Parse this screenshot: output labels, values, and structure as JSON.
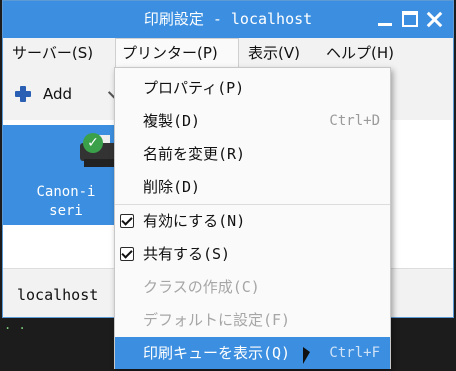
{
  "window": {
    "title": "印刷設定 - localhost"
  },
  "menubar": {
    "items": [
      {
        "label": "サーバー(S)"
      },
      {
        "label": "プリンター(P)"
      },
      {
        "label": "表示(V)"
      },
      {
        "label": "ヘルプ(H)"
      }
    ]
  },
  "toolbar": {
    "add_label": "Add"
  },
  "printer": {
    "name_line1": "Canon-i",
    "name_line2": "seri"
  },
  "status": {
    "server": "localhost"
  },
  "terminal": {
    "text": ". ."
  },
  "dropdown": {
    "items": [
      {
        "label": "プロパティ(P)",
        "accel": "",
        "checked": false,
        "disabled": false
      },
      {
        "label": "複製(D)",
        "accel": "Ctrl+D",
        "checked": false,
        "disabled": false
      },
      {
        "label": "名前を変更(R)",
        "accel": "",
        "checked": false,
        "disabled": false
      },
      {
        "label": "削除(D)",
        "accel": "",
        "checked": false,
        "disabled": false
      },
      {
        "label": "有効にする(N)",
        "accel": "",
        "checked": true,
        "disabled": false
      },
      {
        "label": "共有する(S)",
        "accel": "",
        "checked": true,
        "disabled": false
      },
      {
        "label": "クラスの作成(C)",
        "accel": "",
        "checked": false,
        "disabled": true
      },
      {
        "label": "デフォルトに設定(F)",
        "accel": "",
        "checked": false,
        "disabled": true
      },
      {
        "label": "印刷キューを表示(Q)",
        "accel": "Ctrl+F",
        "checked": false,
        "disabled": false,
        "highlighted": true
      }
    ]
  },
  "colors": {
    "accent": "#3c8fe0"
  }
}
